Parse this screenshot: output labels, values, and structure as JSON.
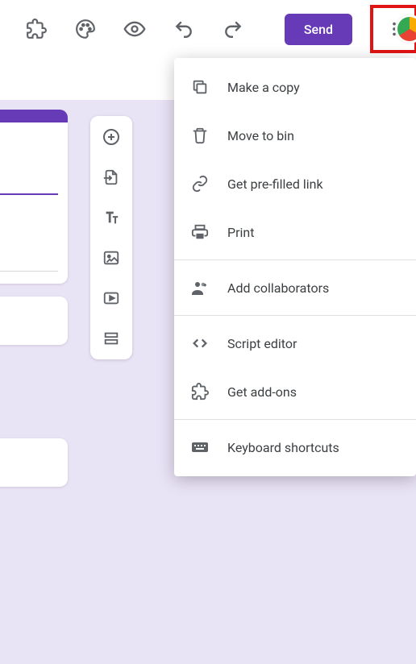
{
  "topbar": {
    "send_label": "Send"
  },
  "menu": {
    "make_copy": "Make a copy",
    "move_to_bin": "Move to bin",
    "prefilled_link": "Get pre-filled link",
    "print": "Print",
    "add_collaborators": "Add collaborators",
    "script_editor": "Script editor",
    "get_addons": "Get add-ons",
    "keyboard_shortcuts": "Keyboard shortcuts"
  }
}
